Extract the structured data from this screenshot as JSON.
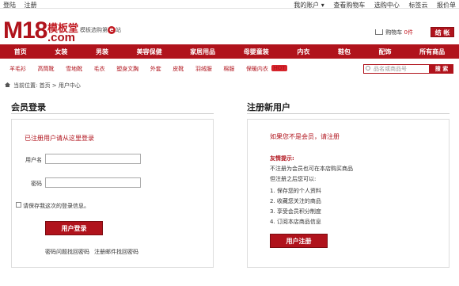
{
  "topbar": {
    "login": "登陆",
    "register": "注册",
    "account": "我的账户 ▾",
    "view_cart": "查看购物车",
    "purchase_list": "选购中心",
    "tags": "标签云",
    "quote": "报价单"
  },
  "header": {
    "logo_m18": "M18",
    "logo_brand": "模板堂",
    "logo_dotcom": ".com",
    "slogan": "模板选购第",
    "slogan_e": "e",
    "slogan_tail": "站",
    "cart_label": "购物车",
    "cart_count": "0件",
    "checkout_label": "结 帐"
  },
  "nav": [
    "首页",
    "女装",
    "男装",
    "美容保健",
    "家居用品",
    "母婴童装",
    "内衣",
    "鞋包",
    "配饰",
    "所有商品"
  ],
  "subnav": {
    "items": [
      "羊毛衫",
      "高筒靴",
      "雪地靴",
      "毛衣",
      "塑身文胸",
      "外套",
      "皮靴",
      "羽绒服",
      "棉服",
      "保暖内衣"
    ],
    "hot_badge": "HOT"
  },
  "search": {
    "placeholder": "品名或商品号",
    "button": "搜 索"
  },
  "breadcrumb": "当前位置: 首页 > 用户中心",
  "login": {
    "title": "会员登录",
    "hint": "已注册用户请从这里登录",
    "username_label": "用户名",
    "password_label": "密码",
    "remember_label": "请保存我这次的登录信息。",
    "login_button": "用户登录",
    "forgot_password": "密码问题找回密码",
    "forgot_by_email": "注册邮件找回密码"
  },
  "register": {
    "title": "注册新用户",
    "hint": "如果您不是会员，请注册",
    "tips_title": "友情提示:",
    "tips_intro1": "不注册为会员也可在本店购买商品",
    "tips_intro2": "但注册之后您可以:",
    "tips": [
      "1. 保存您的个人资料",
      "2. 收藏您关注的商品",
      "3. 享受会员积分制度",
      "4. 订阅本店商品信息"
    ],
    "register_button": "用户注册"
  },
  "colors": {
    "brand_red": "#b0131c"
  }
}
